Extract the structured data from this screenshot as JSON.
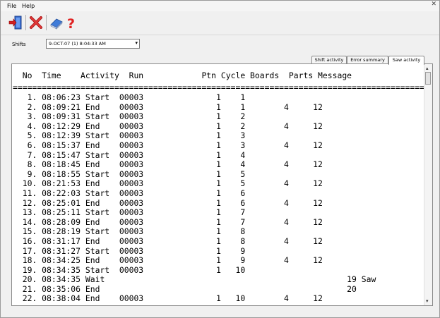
{
  "menu": {
    "items": [
      "File",
      "Help"
    ]
  },
  "toolbar": {
    "buttons": [
      {
        "name": "exit-icon"
      },
      {
        "name": "delete-x-icon"
      },
      {
        "name": "eraser-icon"
      },
      {
        "name": "help-question-icon"
      }
    ]
  },
  "shifts": {
    "label": "Shifts",
    "selected": "9-OCT-07 (1) 8:04:33 AM"
  },
  "tabs": [
    "Shift activity",
    "Error summary",
    "Saw activity"
  ],
  "log": {
    "header": "  No  Time    Activity  Run            Ptn Cycle Boards  Parts Message",
    "separator": "=======================================================================================================",
    "rows": [
      "   1. 08:06:23 Start  00003               1    1",
      "   2. 08:09:21 End    00003               1    1        4     12",
      "   3. 08:09:31 Start  00003               1    2",
      "   4. 08:12:29 End    00003               1    2        4     12",
      "   5. 08:12:39 Start  00003               1    3",
      "   6. 08:15:37 End    00003               1    3        4     12",
      "   7. 08:15:47 Start  00003               1    4",
      "   8. 08:18:45 End    00003               1    4        4     12",
      "   9. 08:18:55 Start  00003               1    5",
      "  10. 08:21:53 End    00003               1    5        4     12",
      "  11. 08:22:03 Start  00003               1    6",
      "  12. 08:25:01 End    00003               1    6        4     12",
      "  13. 08:25:11 Start  00003               1    7",
      "  14. 08:28:09 End    00003               1    7        4     12",
      "  15. 08:28:19 Start  00003               1    8",
      "  16. 08:31:17 End    00003               1    8        4     12",
      "  17. 08:31:27 Start  00003               1    9",
      "  18. 08:34:25 End    00003               1    9        4     12",
      "  19. 08:34:35 Start  00003               1   10",
      "  20. 08:34:35 Wait                                                  19 Saw",
      "  21. 08:35:06 End                                                   20",
      "  22. 08:38:04 End    00003               1   10        4     12"
    ]
  }
}
